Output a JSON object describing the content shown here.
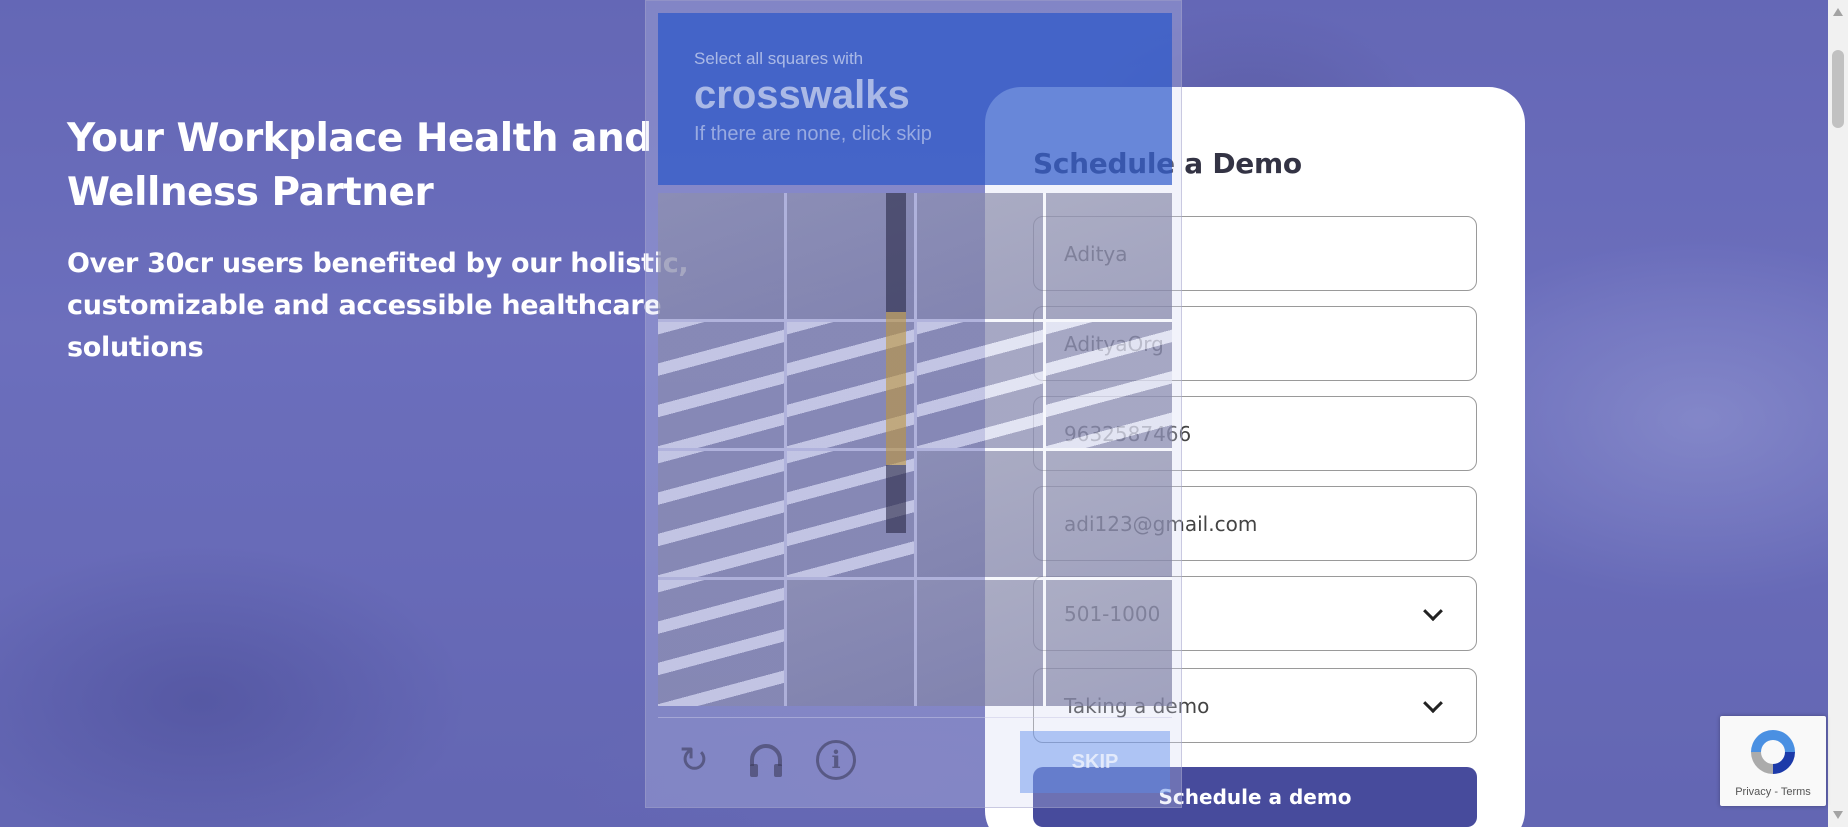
{
  "hero": {
    "title": "Your Workplace Health and Wellness Partner",
    "subtitle": "Over 30cr users benefited by our holistic, customizable and accessible healthcare solutions"
  },
  "form": {
    "title": "Schedule a Demo",
    "fields": {
      "name": "Aditya",
      "organization": "AdityaOrg",
      "phone": "9632587466",
      "email": "adi123@gmail.com",
      "company_size": "501-1000",
      "purpose": "Taking a demo"
    },
    "submit_label": "Schedule a demo"
  },
  "captcha": {
    "instruction": "Select all squares with",
    "target": "crosswalks",
    "hint": "If there are none, click skip",
    "skip_label": "SKIP"
  },
  "recaptcha": {
    "links": "Privacy - Terms"
  },
  "colors": {
    "primary": "#474b9c",
    "captcha_blue": "#2654c8"
  }
}
